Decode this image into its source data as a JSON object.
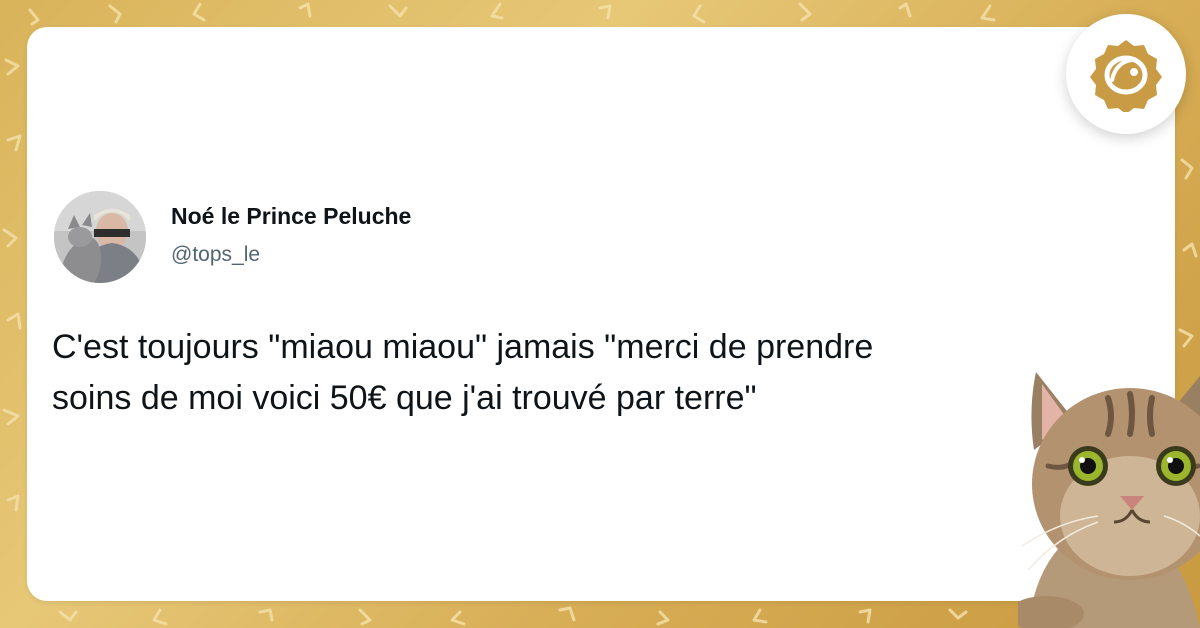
{
  "tweet": {
    "author_name": "Noé le Prince Peluche",
    "author_handle": "@tops_le",
    "text_lines": [
      "C'est toujours \"miaou miaou\" jamais \"merci de prendre",
      "soins de moi voici 50€ que j'ai trouvé par terre\""
    ]
  },
  "icons": {
    "brand_logo": "brand-logo-icon",
    "avatar": "avatar",
    "cat_sticker": "cat-icon"
  },
  "colors": {
    "background": "#ddb561",
    "card": "#ffffff",
    "name_text": "#0f1419",
    "handle_text": "#536471",
    "brand_gold": "#c99b45"
  }
}
